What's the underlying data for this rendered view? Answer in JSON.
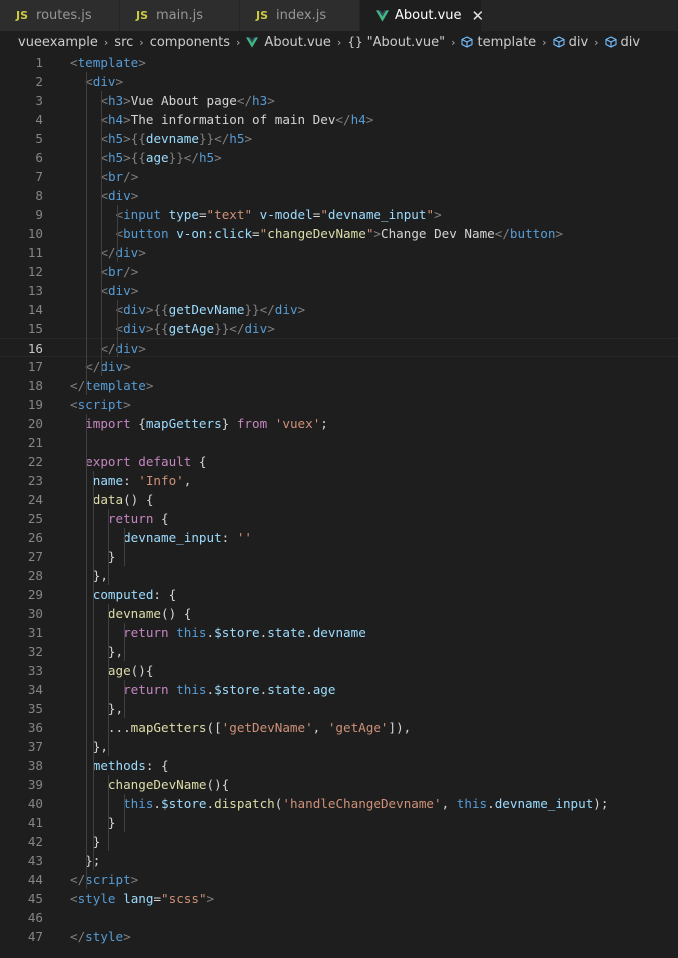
{
  "tabs": [
    {
      "icon": "js-icon",
      "badge": "JS",
      "label": "routes.js",
      "active": false
    },
    {
      "icon": "js-icon",
      "badge": "JS",
      "label": "main.js",
      "active": false
    },
    {
      "icon": "js-icon",
      "badge": "JS",
      "label": "index.js",
      "active": false
    },
    {
      "icon": "vue-icon",
      "badge": "",
      "label": "About.vue",
      "active": true
    }
  ],
  "close_symbol": "✕",
  "breadcrumb": {
    "segments": [
      "vueexample",
      "src",
      "components"
    ],
    "file": "About.vue",
    "object": "\"About.vue\"",
    "object_braces": "{}",
    "elements": [
      "template",
      "div",
      "div"
    ],
    "separator": "›"
  },
  "editor": {
    "current_line": 16,
    "lines": [
      {
        "n": "1",
        "tokens": [
          [
            "tg",
            "<"
          ],
          [
            "tn",
            "template"
          ],
          [
            "tg",
            ">"
          ]
        ]
      },
      {
        "n": "2",
        "tokens": [
          [
            "pl",
            "  "
          ],
          [
            "tg",
            "<"
          ],
          [
            "tn",
            "div"
          ],
          [
            "tg",
            ">"
          ]
        ]
      },
      {
        "n": "3",
        "tokens": [
          [
            "pl",
            "    "
          ],
          [
            "tg",
            "<"
          ],
          [
            "tn",
            "h3"
          ],
          [
            "tg",
            ">"
          ],
          [
            "pl",
            "Vue About page"
          ],
          [
            "tg",
            "</"
          ],
          [
            "tn",
            "h3"
          ],
          [
            "tg",
            ">"
          ]
        ]
      },
      {
        "n": "4",
        "tokens": [
          [
            "pl",
            "    "
          ],
          [
            "tg",
            "<"
          ],
          [
            "tn",
            "h4"
          ],
          [
            "tg",
            ">"
          ],
          [
            "pl",
            "The information of main Dev"
          ],
          [
            "tg",
            "</"
          ],
          [
            "tn",
            "h4"
          ],
          [
            "tg",
            ">"
          ]
        ]
      },
      {
        "n": "5",
        "tokens": [
          [
            "pl",
            "    "
          ],
          [
            "tg",
            "<"
          ],
          [
            "tn",
            "h5"
          ],
          [
            "tg",
            ">"
          ],
          [
            "tg",
            "{{"
          ],
          [
            "vr",
            "devname"
          ],
          [
            "tg",
            "}}"
          ],
          [
            "tg",
            "</"
          ],
          [
            "tn",
            "h5"
          ],
          [
            "tg",
            ">"
          ]
        ]
      },
      {
        "n": "6",
        "tokens": [
          [
            "pl",
            "    "
          ],
          [
            "tg",
            "<"
          ],
          [
            "tn",
            "h5"
          ],
          [
            "tg",
            ">"
          ],
          [
            "tg",
            "{{"
          ],
          [
            "vr",
            "age"
          ],
          [
            "tg",
            "}}"
          ],
          [
            "tg",
            "</"
          ],
          [
            "tn",
            "h5"
          ],
          [
            "tg",
            ">"
          ]
        ]
      },
      {
        "n": "7",
        "tokens": [
          [
            "pl",
            "    "
          ],
          [
            "tg",
            "<"
          ],
          [
            "tn",
            "br"
          ],
          [
            "tg",
            "/>"
          ]
        ]
      },
      {
        "n": "8",
        "tokens": [
          [
            "pl",
            "    "
          ],
          [
            "tg",
            "<"
          ],
          [
            "tn",
            "div"
          ],
          [
            "tg",
            ">"
          ]
        ]
      },
      {
        "n": "9",
        "tokens": [
          [
            "pl",
            "      "
          ],
          [
            "tg",
            "<"
          ],
          [
            "tn",
            "input"
          ],
          [
            "pl",
            " "
          ],
          [
            "at",
            "type"
          ],
          [
            "pl",
            "="
          ],
          [
            "st",
            "\"text\""
          ],
          [
            "pl",
            " "
          ],
          [
            "at",
            "v-model"
          ],
          [
            "pl",
            "="
          ],
          [
            "st",
            "\""
          ],
          [
            "vr",
            "devname_input"
          ],
          [
            "st",
            "\""
          ],
          [
            "tg",
            ">"
          ]
        ]
      },
      {
        "n": "10",
        "tokens": [
          [
            "pl",
            "      "
          ],
          [
            "tg",
            "<"
          ],
          [
            "tn",
            "button"
          ],
          [
            "pl",
            " "
          ],
          [
            "at",
            "v-on"
          ],
          [
            "pl",
            ":"
          ],
          [
            "at",
            "click"
          ],
          [
            "pl",
            "="
          ],
          [
            "st",
            "\""
          ],
          [
            "fn",
            "changeDevName"
          ],
          [
            "st",
            "\""
          ],
          [
            "tg",
            ">"
          ],
          [
            "pl",
            "Change Dev Name"
          ],
          [
            "tg",
            "</"
          ],
          [
            "tn",
            "button"
          ],
          [
            "tg",
            ">"
          ]
        ]
      },
      {
        "n": "11",
        "tokens": [
          [
            "pl",
            "    "
          ],
          [
            "tg",
            "</"
          ],
          [
            "tn",
            "div"
          ],
          [
            "tg",
            ">"
          ]
        ]
      },
      {
        "n": "12",
        "tokens": [
          [
            "pl",
            "    "
          ],
          [
            "tg",
            "<"
          ],
          [
            "tn",
            "br"
          ],
          [
            "tg",
            "/>"
          ]
        ]
      },
      {
        "n": "13",
        "tokens": [
          [
            "pl",
            "    "
          ],
          [
            "tg",
            "<"
          ],
          [
            "tn",
            "div"
          ],
          [
            "tg",
            ">"
          ]
        ]
      },
      {
        "n": "14",
        "tokens": [
          [
            "pl",
            "      "
          ],
          [
            "tg",
            "<"
          ],
          [
            "tn",
            "div"
          ],
          [
            "tg",
            ">"
          ],
          [
            "tg",
            "{{"
          ],
          [
            "vr",
            "getDevName"
          ],
          [
            "tg",
            "}}"
          ],
          [
            "tg",
            "</"
          ],
          [
            "tn",
            "div"
          ],
          [
            "tg",
            ">"
          ]
        ]
      },
      {
        "n": "15",
        "tokens": [
          [
            "pl",
            "      "
          ],
          [
            "tg",
            "<"
          ],
          [
            "tn",
            "div"
          ],
          [
            "tg",
            ">"
          ],
          [
            "tg",
            "{{"
          ],
          [
            "vr",
            "getAge"
          ],
          [
            "tg",
            "}}"
          ],
          [
            "tg",
            "</"
          ],
          [
            "tn",
            "div"
          ],
          [
            "tg",
            ">"
          ]
        ]
      },
      {
        "n": "16",
        "tokens": [
          [
            "pl",
            "    "
          ],
          [
            "tg",
            "</"
          ],
          [
            "tn",
            "div"
          ],
          [
            "tg",
            ">"
          ]
        ]
      },
      {
        "n": "17",
        "tokens": [
          [
            "pl",
            "  "
          ],
          [
            "tg",
            "</"
          ],
          [
            "tn",
            "div"
          ],
          [
            "tg",
            ">"
          ]
        ]
      },
      {
        "n": "18",
        "tokens": [
          [
            "tg",
            "</"
          ],
          [
            "tn",
            "template"
          ],
          [
            "tg",
            ">"
          ]
        ]
      },
      {
        "n": "19",
        "tokens": [
          [
            "tg",
            "<"
          ],
          [
            "tn",
            "script"
          ],
          [
            "tg",
            ">"
          ]
        ]
      },
      {
        "n": "20",
        "tokens": [
          [
            "pl",
            "  "
          ],
          [
            "kw",
            "import"
          ],
          [
            "pl",
            " {"
          ],
          [
            "vr",
            "mapGetters"
          ],
          [
            "pl",
            "} "
          ],
          [
            "kw",
            "from"
          ],
          [
            "pl",
            " "
          ],
          [
            "st",
            "'vuex'"
          ],
          [
            "pl",
            ";"
          ]
        ]
      },
      {
        "n": "21",
        "tokens": []
      },
      {
        "n": "22",
        "tokens": [
          [
            "pl",
            "  "
          ],
          [
            "kw",
            "export"
          ],
          [
            "pl",
            " "
          ],
          [
            "kw",
            "default"
          ],
          [
            "pl",
            " {"
          ]
        ]
      },
      {
        "n": "23",
        "tokens": [
          [
            "pl",
            "   "
          ],
          [
            "vr",
            "name"
          ],
          [
            "pl",
            ": "
          ],
          [
            "st",
            "'Info'"
          ],
          [
            "pl",
            ","
          ]
        ]
      },
      {
        "n": "24",
        "tokens": [
          [
            "pl",
            "   "
          ],
          [
            "fn",
            "data"
          ],
          [
            "pl",
            "() {"
          ]
        ]
      },
      {
        "n": "25",
        "tokens": [
          [
            "pl",
            "     "
          ],
          [
            "kw",
            "return"
          ],
          [
            "pl",
            " {"
          ]
        ]
      },
      {
        "n": "26",
        "tokens": [
          [
            "pl",
            "       "
          ],
          [
            "vr",
            "devname_input"
          ],
          [
            "pl",
            ": "
          ],
          [
            "st",
            "''"
          ]
        ]
      },
      {
        "n": "27",
        "tokens": [
          [
            "pl",
            "     }"
          ]
        ]
      },
      {
        "n": "28",
        "tokens": [
          [
            "pl",
            "   },"
          ]
        ]
      },
      {
        "n": "29",
        "tokens": [
          [
            "pl",
            "   "
          ],
          [
            "vr",
            "computed"
          ],
          [
            "pl",
            ": {"
          ]
        ]
      },
      {
        "n": "30",
        "tokens": [
          [
            "pl",
            "     "
          ],
          [
            "fn",
            "devname"
          ],
          [
            "pl",
            "() {"
          ]
        ]
      },
      {
        "n": "31",
        "tokens": [
          [
            "pl",
            "       "
          ],
          [
            "kw",
            "return"
          ],
          [
            "pl",
            " "
          ],
          [
            "th",
            "this"
          ],
          [
            "pl",
            "."
          ],
          [
            "vr",
            "$store"
          ],
          [
            "pl",
            "."
          ],
          [
            "vr",
            "state"
          ],
          [
            "pl",
            "."
          ],
          [
            "vr",
            "devname"
          ]
        ]
      },
      {
        "n": "32",
        "tokens": [
          [
            "pl",
            "     },"
          ]
        ]
      },
      {
        "n": "33",
        "tokens": [
          [
            "pl",
            "     "
          ],
          [
            "fn",
            "age"
          ],
          [
            "pl",
            "(){"
          ]
        ]
      },
      {
        "n": "34",
        "tokens": [
          [
            "pl",
            "       "
          ],
          [
            "kw",
            "return"
          ],
          [
            "pl",
            " "
          ],
          [
            "th",
            "this"
          ],
          [
            "pl",
            "."
          ],
          [
            "vr",
            "$store"
          ],
          [
            "pl",
            "."
          ],
          [
            "vr",
            "state"
          ],
          [
            "pl",
            "."
          ],
          [
            "vr",
            "age"
          ]
        ]
      },
      {
        "n": "35",
        "tokens": [
          [
            "pl",
            "     },"
          ]
        ]
      },
      {
        "n": "36",
        "tokens": [
          [
            "pl",
            "     ..."
          ],
          [
            "fn",
            "mapGetters"
          ],
          [
            "pl",
            "(["
          ],
          [
            "st",
            "'getDevName'"
          ],
          [
            "pl",
            ", "
          ],
          [
            "st",
            "'getAge'"
          ],
          [
            "pl",
            "]),"
          ]
        ]
      },
      {
        "n": "37",
        "tokens": [
          [
            "pl",
            "   },"
          ]
        ]
      },
      {
        "n": "38",
        "tokens": [
          [
            "pl",
            "   "
          ],
          [
            "vr",
            "methods"
          ],
          [
            "pl",
            ": {"
          ]
        ]
      },
      {
        "n": "39",
        "tokens": [
          [
            "pl",
            "     "
          ],
          [
            "fn",
            "changeDevName"
          ],
          [
            "pl",
            "(){"
          ]
        ]
      },
      {
        "n": "40",
        "tokens": [
          [
            "pl",
            "       "
          ],
          [
            "th",
            "this"
          ],
          [
            "pl",
            "."
          ],
          [
            "vr",
            "$store"
          ],
          [
            "pl",
            "."
          ],
          [
            "fn",
            "dispatch"
          ],
          [
            "pl",
            "("
          ],
          [
            "st",
            "'handleChangeDevname'"
          ],
          [
            "pl",
            ", "
          ],
          [
            "th",
            "this"
          ],
          [
            "pl",
            "."
          ],
          [
            "vr",
            "devname_input"
          ],
          [
            "pl",
            ");"
          ]
        ]
      },
      {
        "n": "41",
        "tokens": [
          [
            "pl",
            "     }"
          ]
        ]
      },
      {
        "n": "42",
        "tokens": [
          [
            "pl",
            "   }"
          ]
        ]
      },
      {
        "n": "43",
        "tokens": [
          [
            "pl",
            "  };"
          ]
        ]
      },
      {
        "n": "44",
        "tokens": [
          [
            "tg",
            "</"
          ],
          [
            "tn",
            "script"
          ],
          [
            "tg",
            ">"
          ]
        ]
      },
      {
        "n": "45",
        "tokens": [
          [
            "tg",
            "<"
          ],
          [
            "tn",
            "style"
          ],
          [
            "pl",
            " "
          ],
          [
            "at",
            "lang"
          ],
          [
            "pl",
            "="
          ],
          [
            "st",
            "\"scss\""
          ],
          [
            "tg",
            ">"
          ]
        ]
      },
      {
        "n": "46",
        "tokens": []
      },
      {
        "n": "47",
        "tokens": [
          [
            "tg",
            "</"
          ],
          [
            "tn",
            "style"
          ],
          [
            "tg",
            ">"
          ]
        ]
      }
    ]
  }
}
